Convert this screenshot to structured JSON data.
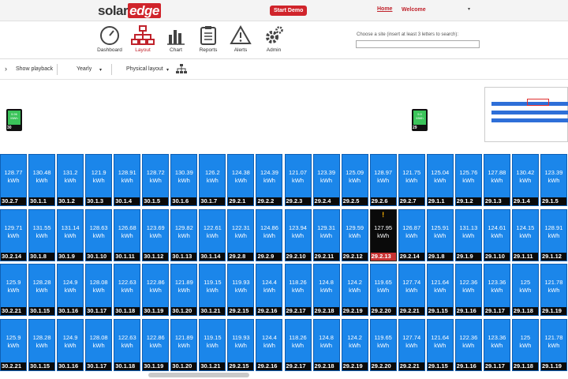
{
  "header": {
    "logo_solar": "solar",
    "logo_edge": "edge",
    "start_demo": "Start Demo",
    "home": "Home",
    "welcome": "Welcome",
    "welcome_caret": "▾"
  },
  "nav": {
    "dashboard": "Dashboard",
    "layout": "Layout",
    "chart": "Chart",
    "reports": "Reports",
    "alerts": "Alerts",
    "admin": "Admin",
    "site_label": "Choose a site (insert at least 3 letters to search):",
    "site_value": ""
  },
  "toolbar": {
    "playback_arrow": "›",
    "show_playback": "Show playback",
    "period": "Yearly",
    "period_caret": "▾",
    "layout_mode": "Physical layout",
    "layout_caret": "▾"
  },
  "inverters": [
    {
      "energy": "5.96",
      "unit": "MWh",
      "id": "30"
    },
    {
      "energy": "5.9",
      "unit": "MWh",
      "id": "29"
    }
  ],
  "colors": {
    "panel": "#1b86ea",
    "panel_label": "#0a0a0a",
    "alert_label": "#c83232",
    "brand_red": "#d0242b",
    "inverter_screen": "#3bc45a"
  },
  "alert_mark": "!",
  "rows": [
    [
      {
        "v": "128.77",
        "u": "kWh",
        "id": "30.2.7"
      },
      {
        "v": "130.48",
        "u": "kWh",
        "id": "30.1.1"
      },
      {
        "v": "131.2",
        "u": "kWh",
        "id": "30.1.2"
      },
      {
        "v": "121.9",
        "u": "kWh",
        "id": "30.1.3"
      },
      {
        "v": "128.91",
        "u": "kWh",
        "id": "30.1.4"
      },
      {
        "v": "128.72",
        "u": "kWh",
        "id": "30.1.5"
      },
      {
        "v": "130.39",
        "u": "kWh",
        "id": "30.1.6"
      },
      {
        "v": "126.2",
        "u": "kWh",
        "id": "30.1.7"
      },
      {
        "v": "124.38",
        "u": "kWh",
        "id": "29.2.1"
      },
      {
        "v": "124.39",
        "u": "kWh",
        "id": "29.2.2"
      },
      {
        "v": "121.07",
        "u": "kWh",
        "id": "29.2.3"
      },
      {
        "v": "123.39",
        "u": "kWh",
        "id": "29.2.4"
      },
      {
        "v": "125.09",
        "u": "kWh",
        "id": "29.2.5"
      },
      {
        "v": "128.97",
        "u": "kWh",
        "id": "29.2.6"
      },
      {
        "v": "121.75",
        "u": "kWh",
        "id": "29.2.7"
      },
      {
        "v": "125.04",
        "u": "kWh",
        "id": "29.1.1"
      },
      {
        "v": "125.76",
        "u": "kWh",
        "id": "29.1.2"
      },
      {
        "v": "127.88",
        "u": "kWh",
        "id": "29.1.3"
      },
      {
        "v": "130.42",
        "u": "kWh",
        "id": "29.1.4"
      },
      {
        "v": "123.39",
        "u": "kWh",
        "id": "29.1.5"
      }
    ],
    [
      {
        "v": "129.71",
        "u": "kWh",
        "id": "30.2.14"
      },
      {
        "v": "131.55",
        "u": "kWh",
        "id": "30.1.8"
      },
      {
        "v": "131.14",
        "u": "kWh",
        "id": "30.1.9"
      },
      {
        "v": "128.63",
        "u": "kWh",
        "id": "30.1.10"
      },
      {
        "v": "126.68",
        "u": "kWh",
        "id": "30.1.11"
      },
      {
        "v": "123.69",
        "u": "kWh",
        "id": "30.1.12"
      },
      {
        "v": "129.82",
        "u": "kWh",
        "id": "30.1.13"
      },
      {
        "v": "122.61",
        "u": "kWh",
        "id": "30.1.14"
      },
      {
        "v": "122.31",
        "u": "kWh",
        "id": "29.2.8"
      },
      {
        "v": "124.86",
        "u": "kWh",
        "id": "29.2.9"
      },
      {
        "v": "123.94",
        "u": "kWh",
        "id": "29.2.10"
      },
      {
        "v": "129.31",
        "u": "kWh",
        "id": "29.2.11"
      },
      {
        "v": "129.59",
        "u": "kWh",
        "id": "29.2.12"
      },
      {
        "v": "127.95",
        "u": "kWh",
        "id": "29.2.13",
        "alert": true
      },
      {
        "v": "126.87",
        "u": "kWh",
        "id": "29.2.14"
      },
      {
        "v": "125.91",
        "u": "kWh",
        "id": "29.1.8"
      },
      {
        "v": "131.13",
        "u": "kWh",
        "id": "29.1.9"
      },
      {
        "v": "124.61",
        "u": "kWh",
        "id": "29.1.10"
      },
      {
        "v": "124.15",
        "u": "kWh",
        "id": "29.1.11"
      },
      {
        "v": "128.91",
        "u": "kWh",
        "id": "29.1.12"
      }
    ],
    [
      {
        "v": "125.9",
        "u": "kWh",
        "id": "30.2.21"
      },
      {
        "v": "128.28",
        "u": "kWh",
        "id": "30.1.15"
      },
      {
        "v": "124.9",
        "u": "kWh",
        "id": "30.1.16"
      },
      {
        "v": "128.08",
        "u": "kWh",
        "id": "30.1.17"
      },
      {
        "v": "122.63",
        "u": "kWh",
        "id": "30.1.18"
      },
      {
        "v": "122.86",
        "u": "kWh",
        "id": "30.1.19"
      },
      {
        "v": "121.89",
        "u": "kWh",
        "id": "30.1.20"
      },
      {
        "v": "119.15",
        "u": "kWh",
        "id": "30.1.21"
      },
      {
        "v": "119.93",
        "u": "kWh",
        "id": "29.2.15"
      },
      {
        "v": "124.4",
        "u": "kWh",
        "id": "29.2.16"
      },
      {
        "v": "118.26",
        "u": "kWh",
        "id": "29.2.17"
      },
      {
        "v": "124.8",
        "u": "kWh",
        "id": "29.2.18"
      },
      {
        "v": "124.2",
        "u": "kWh",
        "id": "29.2.19"
      },
      {
        "v": "119.65",
        "u": "kWh",
        "id": "29.2.20"
      },
      {
        "v": "127.74",
        "u": "kWh",
        "id": "29.2.21"
      },
      {
        "v": "121.64",
        "u": "kWh",
        "id": "29.1.15"
      },
      {
        "v": "122.36",
        "u": "kWh",
        "id": "29.1.16"
      },
      {
        "v": "123.36",
        "u": "kWh",
        "id": "29.1.17"
      },
      {
        "v": "125",
        "u": "kWh",
        "id": "29.1.18"
      },
      {
        "v": "121.78",
        "u": "kWh",
        "id": "29.1.19"
      }
    ],
    [
      {
        "v": "125.9",
        "u": "kWh",
        "id": "30.2.21"
      },
      {
        "v": "128.28",
        "u": "kWh",
        "id": "30.1.15"
      },
      {
        "v": "124.9",
        "u": "kWh",
        "id": "30.1.16"
      },
      {
        "v": "128.08",
        "u": "kWh",
        "id": "30.1.17"
      },
      {
        "v": "122.63",
        "u": "kWh",
        "id": "30.1.18"
      },
      {
        "v": "122.86",
        "u": "kWh",
        "id": "30.1.19"
      },
      {
        "v": "121.89",
        "u": "kWh",
        "id": "30.1.20"
      },
      {
        "v": "119.15",
        "u": "kWh",
        "id": "30.1.21"
      },
      {
        "v": "119.93",
        "u": "kWh",
        "id": "29.2.15"
      },
      {
        "v": "124.4",
        "u": "kWh",
        "id": "29.2.16"
      },
      {
        "v": "118.26",
        "u": "kWh",
        "id": "29.2.17"
      },
      {
        "v": "124.8",
        "u": "kWh",
        "id": "29.2.18"
      },
      {
        "v": "124.2",
        "u": "kWh",
        "id": "29.2.19"
      },
      {
        "v": "119.65",
        "u": "kWh",
        "id": "29.2.20"
      },
      {
        "v": "127.74",
        "u": "kWh",
        "id": "29.2.21"
      },
      {
        "v": "121.64",
        "u": "kWh",
        "id": "29.1.15"
      },
      {
        "v": "122.36",
        "u": "kWh",
        "id": "29.1.16"
      },
      {
        "v": "123.36",
        "u": "kWh",
        "id": "29.1.17"
      },
      {
        "v": "125",
        "u": "kWh",
        "id": "29.1.18"
      },
      {
        "v": "121.78",
        "u": "kWh",
        "id": "29.1.19"
      }
    ]
  ]
}
